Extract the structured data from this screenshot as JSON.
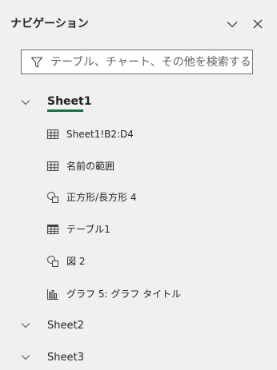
{
  "header": {
    "title": "ナビゲーション",
    "collapse_icon": "chevron-down-icon",
    "close_icon": "close-icon"
  },
  "search": {
    "placeholder": "テーブル、チャート、その他を検索する",
    "value": "",
    "icon": "filter-icon"
  },
  "colors": {
    "accent": "#1e7145",
    "background": "#f0f0f0",
    "text": "#242424"
  },
  "sheets": [
    {
      "label": "Sheet1",
      "expanded": true,
      "active": true,
      "items": [
        {
          "label": "Sheet1!B2:D4",
          "icon": "range-grid-icon"
        },
        {
          "label": "名前の範囲",
          "icon": "named-range-grid-icon"
        },
        {
          "label": "正方形/長方形 4",
          "icon": "shapes-icon"
        },
        {
          "label": "テーブル1",
          "icon": "table-icon"
        },
        {
          "label": "図 2",
          "icon": "shapes-icon"
        },
        {
          "label": "グラフ 5: グラフ タイトル",
          "icon": "chart-icon"
        }
      ]
    },
    {
      "label": "Sheet2",
      "expanded": false,
      "active": false
    },
    {
      "label": "Sheet3",
      "expanded": false,
      "active": false
    }
  ]
}
